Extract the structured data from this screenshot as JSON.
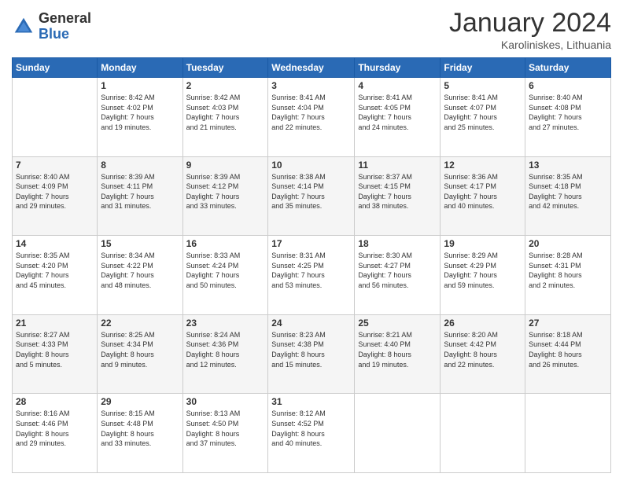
{
  "header": {
    "logo_general": "General",
    "logo_blue": "Blue",
    "month_title": "January 2024",
    "location": "Karoliniskes, Lithuania"
  },
  "weekdays": [
    "Sunday",
    "Monday",
    "Tuesday",
    "Wednesday",
    "Thursday",
    "Friday",
    "Saturday"
  ],
  "weeks": [
    [
      {
        "day": "",
        "info": ""
      },
      {
        "day": "1",
        "info": "Sunrise: 8:42 AM\nSunset: 4:02 PM\nDaylight: 7 hours\nand 19 minutes."
      },
      {
        "day": "2",
        "info": "Sunrise: 8:42 AM\nSunset: 4:03 PM\nDaylight: 7 hours\nand 21 minutes."
      },
      {
        "day": "3",
        "info": "Sunrise: 8:41 AM\nSunset: 4:04 PM\nDaylight: 7 hours\nand 22 minutes."
      },
      {
        "day": "4",
        "info": "Sunrise: 8:41 AM\nSunset: 4:05 PM\nDaylight: 7 hours\nand 24 minutes."
      },
      {
        "day": "5",
        "info": "Sunrise: 8:41 AM\nSunset: 4:07 PM\nDaylight: 7 hours\nand 25 minutes."
      },
      {
        "day": "6",
        "info": "Sunrise: 8:40 AM\nSunset: 4:08 PM\nDaylight: 7 hours\nand 27 minutes."
      }
    ],
    [
      {
        "day": "7",
        "info": "Sunrise: 8:40 AM\nSunset: 4:09 PM\nDaylight: 7 hours\nand 29 minutes."
      },
      {
        "day": "8",
        "info": "Sunrise: 8:39 AM\nSunset: 4:11 PM\nDaylight: 7 hours\nand 31 minutes."
      },
      {
        "day": "9",
        "info": "Sunrise: 8:39 AM\nSunset: 4:12 PM\nDaylight: 7 hours\nand 33 minutes."
      },
      {
        "day": "10",
        "info": "Sunrise: 8:38 AM\nSunset: 4:14 PM\nDaylight: 7 hours\nand 35 minutes."
      },
      {
        "day": "11",
        "info": "Sunrise: 8:37 AM\nSunset: 4:15 PM\nDaylight: 7 hours\nand 38 minutes."
      },
      {
        "day": "12",
        "info": "Sunrise: 8:36 AM\nSunset: 4:17 PM\nDaylight: 7 hours\nand 40 minutes."
      },
      {
        "day": "13",
        "info": "Sunrise: 8:35 AM\nSunset: 4:18 PM\nDaylight: 7 hours\nand 42 minutes."
      }
    ],
    [
      {
        "day": "14",
        "info": "Sunrise: 8:35 AM\nSunset: 4:20 PM\nDaylight: 7 hours\nand 45 minutes."
      },
      {
        "day": "15",
        "info": "Sunrise: 8:34 AM\nSunset: 4:22 PM\nDaylight: 7 hours\nand 48 minutes."
      },
      {
        "day": "16",
        "info": "Sunrise: 8:33 AM\nSunset: 4:24 PM\nDaylight: 7 hours\nand 50 minutes."
      },
      {
        "day": "17",
        "info": "Sunrise: 8:31 AM\nSunset: 4:25 PM\nDaylight: 7 hours\nand 53 minutes."
      },
      {
        "day": "18",
        "info": "Sunrise: 8:30 AM\nSunset: 4:27 PM\nDaylight: 7 hours\nand 56 minutes."
      },
      {
        "day": "19",
        "info": "Sunrise: 8:29 AM\nSunset: 4:29 PM\nDaylight: 7 hours\nand 59 minutes."
      },
      {
        "day": "20",
        "info": "Sunrise: 8:28 AM\nSunset: 4:31 PM\nDaylight: 8 hours\nand 2 minutes."
      }
    ],
    [
      {
        "day": "21",
        "info": "Sunrise: 8:27 AM\nSunset: 4:33 PM\nDaylight: 8 hours\nand 5 minutes."
      },
      {
        "day": "22",
        "info": "Sunrise: 8:25 AM\nSunset: 4:34 PM\nDaylight: 8 hours\nand 9 minutes."
      },
      {
        "day": "23",
        "info": "Sunrise: 8:24 AM\nSunset: 4:36 PM\nDaylight: 8 hours\nand 12 minutes."
      },
      {
        "day": "24",
        "info": "Sunrise: 8:23 AM\nSunset: 4:38 PM\nDaylight: 8 hours\nand 15 minutes."
      },
      {
        "day": "25",
        "info": "Sunrise: 8:21 AM\nSunset: 4:40 PM\nDaylight: 8 hours\nand 19 minutes."
      },
      {
        "day": "26",
        "info": "Sunrise: 8:20 AM\nSunset: 4:42 PM\nDaylight: 8 hours\nand 22 minutes."
      },
      {
        "day": "27",
        "info": "Sunrise: 8:18 AM\nSunset: 4:44 PM\nDaylight: 8 hours\nand 26 minutes."
      }
    ],
    [
      {
        "day": "28",
        "info": "Sunrise: 8:16 AM\nSunset: 4:46 PM\nDaylight: 8 hours\nand 29 minutes."
      },
      {
        "day": "29",
        "info": "Sunrise: 8:15 AM\nSunset: 4:48 PM\nDaylight: 8 hours\nand 33 minutes."
      },
      {
        "day": "30",
        "info": "Sunrise: 8:13 AM\nSunset: 4:50 PM\nDaylight: 8 hours\nand 37 minutes."
      },
      {
        "day": "31",
        "info": "Sunrise: 8:12 AM\nSunset: 4:52 PM\nDaylight: 8 hours\nand 40 minutes."
      },
      {
        "day": "",
        "info": ""
      },
      {
        "day": "",
        "info": ""
      },
      {
        "day": "",
        "info": ""
      }
    ]
  ]
}
